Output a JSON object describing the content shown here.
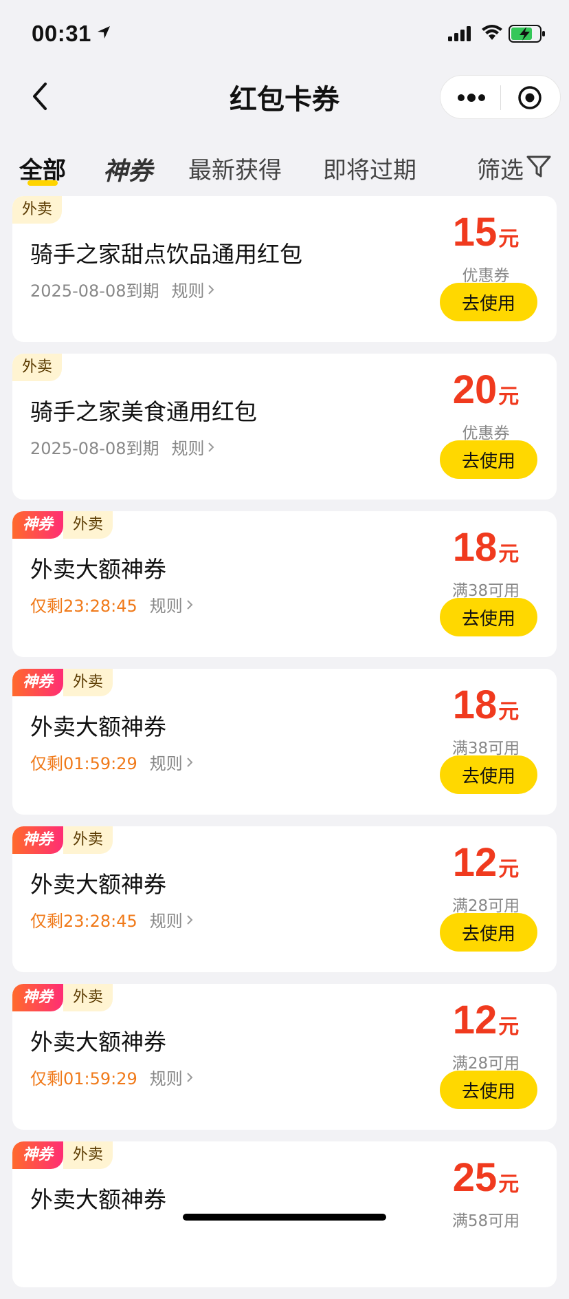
{
  "status_bar": {
    "time": "00:31"
  },
  "nav": {
    "title": "红包卡券"
  },
  "tabs": [
    {
      "label": "全部",
      "active": true
    },
    {
      "label": "神券"
    },
    {
      "label": "最新获得"
    },
    {
      "label": "即将过期"
    },
    {
      "label": "筛选"
    }
  ],
  "coupons": [
    {
      "tags": [
        "外卖"
      ],
      "title": "骑手之家甜点饮品通用红包",
      "expire": "2025-08-08到期",
      "rule": "规则",
      "amount": "15",
      "unit": "元",
      "desc": "优惠券",
      "button": "去使用"
    },
    {
      "tags": [
        "外卖"
      ],
      "title": "骑手之家美食通用红包",
      "expire": "2025-08-08到期",
      "rule": "规则",
      "amount": "20",
      "unit": "元",
      "desc": "优惠券",
      "button": "去使用"
    },
    {
      "tags": [
        "神券",
        "外卖"
      ],
      "title": "外卖大额神券",
      "expire": "仅剩23:28:45",
      "rule": "规则",
      "amount": "18",
      "unit": "元",
      "desc": "满38可用",
      "button": "去使用"
    },
    {
      "tags": [
        "神券",
        "外卖"
      ],
      "title": "外卖大额神券",
      "expire": "仅剩01:59:29",
      "rule": "规则",
      "amount": "18",
      "unit": "元",
      "desc": "满38可用",
      "button": "去使用"
    },
    {
      "tags": [
        "神券",
        "外卖"
      ],
      "title": "外卖大额神券",
      "expire": "仅剩23:28:45",
      "rule": "规则",
      "amount": "12",
      "unit": "元",
      "desc": "满28可用",
      "button": "去使用"
    },
    {
      "tags": [
        "神券",
        "外卖"
      ],
      "title": "外卖大额神券",
      "expire": "仅剩01:59:29",
      "rule": "规则",
      "amount": "12",
      "unit": "元",
      "desc": "满28可用",
      "button": "去使用"
    },
    {
      "tags": [
        "神券",
        "外卖"
      ],
      "title": "外卖大额神券",
      "expire": "",
      "rule": "",
      "amount": "25",
      "unit": "元",
      "desc": "满58可用",
      "button": ""
    }
  ],
  "colors": {
    "accent_yellow": "#ffd800",
    "price_red": "#f03a1e",
    "countdown_orange": "#f07a1a"
  },
  "icons": [
    "location-arrow-icon",
    "signal-icon",
    "wifi-icon",
    "battery-charging-icon",
    "back-chevron-icon",
    "more-dots-icon",
    "target-icon",
    "filter-icon",
    "chevron-right-icon"
  ]
}
